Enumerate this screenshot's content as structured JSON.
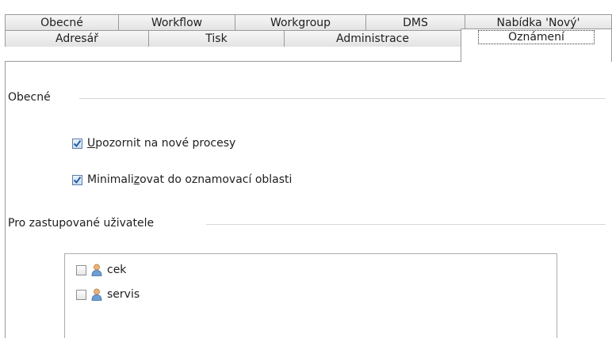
{
  "tabs_row1": [
    {
      "label": "Obecné"
    },
    {
      "label": "Workflow"
    },
    {
      "label": "Workgroup"
    },
    {
      "label": "DMS"
    },
    {
      "label": "Nabídka 'Nový'"
    }
  ],
  "tabs_row2": [
    {
      "label": "Adresář"
    },
    {
      "label": "Tisk"
    },
    {
      "label": "Administrace"
    },
    {
      "label": "Oznámení",
      "active": true
    }
  ],
  "general_group": {
    "title": "Obecné",
    "notify_new": {
      "pre": "",
      "mnemonic": "U",
      "post": "pozornit na nové procesy",
      "checked": true
    },
    "minimize": {
      "pre": "Minimali",
      "mnemonic": "z",
      "post": "ovat do oznamovací oblasti",
      "checked": true
    }
  },
  "represented_group": {
    "title": "Pro zastupované uživatele",
    "users": [
      {
        "name": "cek",
        "checked": false,
        "icon": "user-icon"
      },
      {
        "name": "servis",
        "checked": false,
        "icon": "user-icon"
      }
    ]
  },
  "colors": {
    "check_blue": "#2b5fa8",
    "border": "#9a9a9a"
  }
}
